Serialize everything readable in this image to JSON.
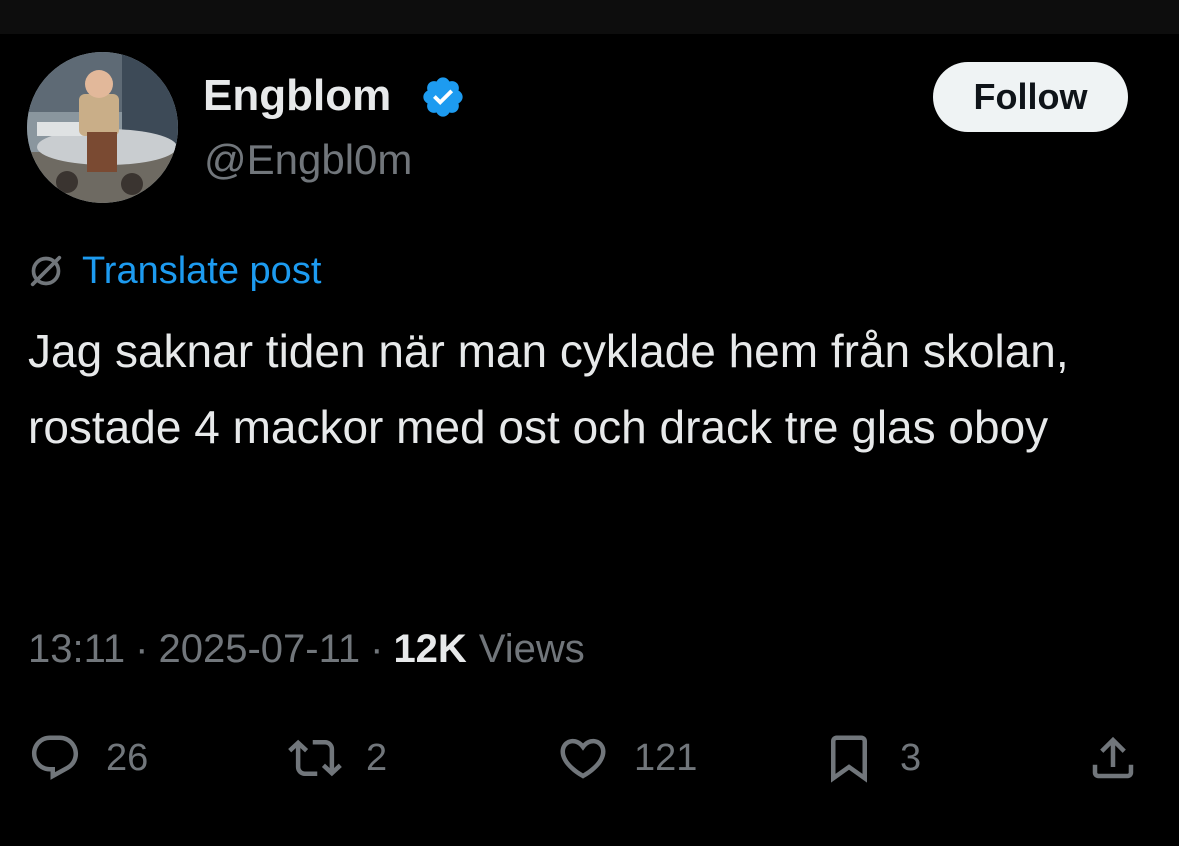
{
  "author": {
    "display_name": "Engblom",
    "handle": "@Engbl0m",
    "verified": true
  },
  "follow_label": "Follow",
  "translate_label": "Translate post",
  "post_text": "Jag saknar tiden när man cyklade hem från skolan, rostade 4 mackor med ost och drack tre glas oboy",
  "meta": {
    "time": "13:11",
    "date": "2025-07-11",
    "separator": "·",
    "views_count": "12K",
    "views_label": "Views"
  },
  "actions": {
    "replies": "26",
    "reposts": "2",
    "likes": "121",
    "bookmarks": "3"
  },
  "colors": {
    "background": "#000000",
    "text_primary": "#e7e9ea",
    "text_secondary": "#71767b",
    "accent": "#1d9bf0",
    "follow_bg": "#eff3f4"
  },
  "icons": [
    "verified-badge-icon",
    "translate-icon",
    "reply-icon",
    "repost-icon",
    "like-icon",
    "bookmark-icon",
    "share-icon"
  ]
}
